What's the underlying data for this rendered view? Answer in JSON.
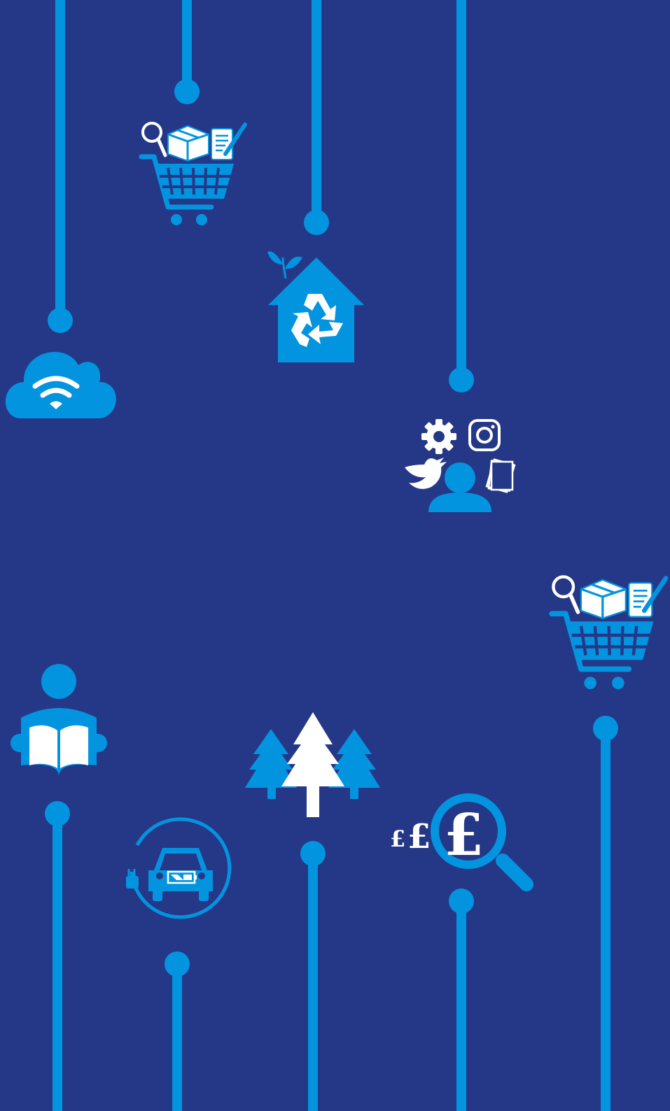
{
  "colors": {
    "background": "#253887",
    "accent": "#0394e0",
    "icon_light": "#ffffff"
  },
  "icons": [
    "cloud-wifi-icon",
    "shopping-cart-icon",
    "recycling-house-icon",
    "social-media-icon",
    "reading-person-icon",
    "electric-car-icon",
    "pine-trees-icon",
    "price-search-icon"
  ],
  "currency": {
    "small": "£",
    "medium": "£",
    "large": "£"
  }
}
